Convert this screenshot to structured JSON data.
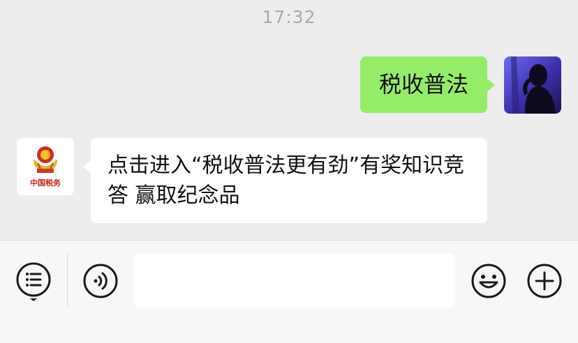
{
  "timestamp": "17:32",
  "messages": [
    {
      "direction": "outgoing",
      "text": "税收普法"
    },
    {
      "direction": "incoming",
      "text": "点击进入“税收普法更有劲”有奖知识竞答 赢取纪念品"
    }
  ],
  "avatars": {
    "self": "user-avatar",
    "sender": "china-tax-logo",
    "sender_logo_text": "中国税务"
  },
  "input_bar": {
    "message_input_value": "",
    "icons": [
      "menu-list-icon",
      "voice-icon",
      "emoji-icon",
      "plus-icon"
    ]
  },
  "colors": {
    "outgoing_bubble": "#95ec69",
    "incoming_bubble": "#ffffff",
    "background": "#ededed",
    "timestamp": "#a9a9a9"
  }
}
